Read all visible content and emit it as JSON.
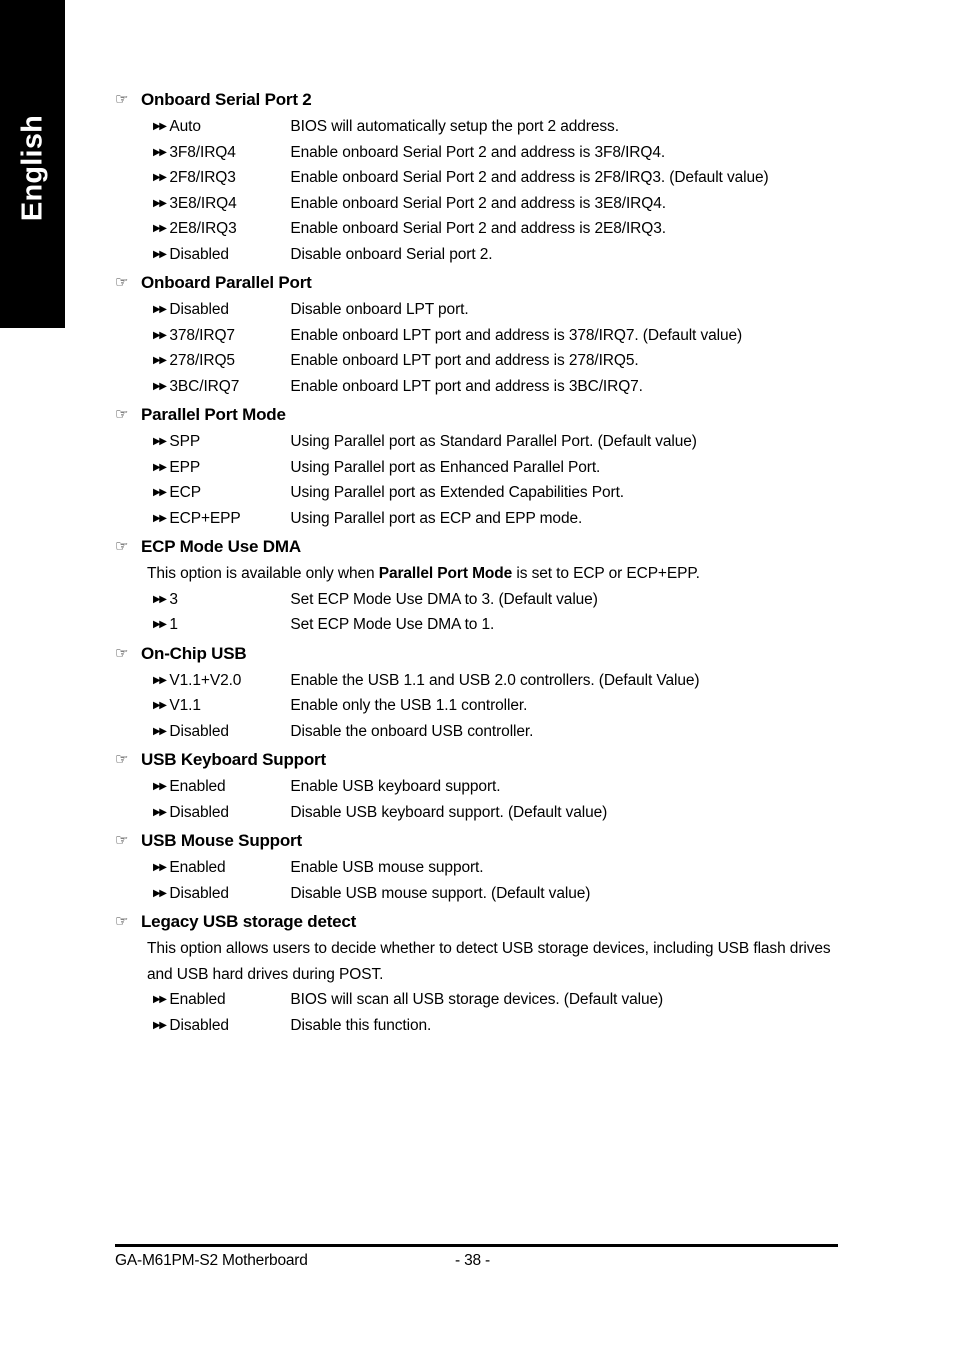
{
  "language_tab": {
    "label": "English",
    "background_color": "#000000",
    "text_color": "#ffffff"
  },
  "icons": {
    "section_bullet": "☞",
    "option_bullet": "▶▶"
  },
  "sections": [
    {
      "title": "Onboard Serial Port 2",
      "note": null,
      "options": [
        {
          "name": "Auto",
          "desc": "BIOS will automatically setup the port 2 address."
        },
        {
          "name": "3F8/IRQ4",
          "desc": "Enable onboard Serial Port 2 and address is 3F8/IRQ4."
        },
        {
          "name": "2F8/IRQ3",
          "desc": "Enable onboard Serial Port 2 and address is 2F8/IRQ3. (Default value)"
        },
        {
          "name": "3E8/IRQ4",
          "desc": "Enable onboard Serial Port 2 and address is 3E8/IRQ4."
        },
        {
          "name": "2E8/IRQ3",
          "desc": "Enable onboard Serial Port 2 and address is 2E8/IRQ3."
        },
        {
          "name": "Disabled",
          "desc": "Disable onboard Serial port 2."
        }
      ]
    },
    {
      "title": "Onboard Parallel Port",
      "note": null,
      "options": [
        {
          "name": "Disabled",
          "desc": "Disable onboard LPT port."
        },
        {
          "name": "378/IRQ7",
          "desc": "Enable onboard LPT port and address is 378/IRQ7. (Default value)"
        },
        {
          "name": "278/IRQ5",
          "desc": "Enable onboard LPT port and address is 278/IRQ5."
        },
        {
          "name": "3BC/IRQ7",
          "desc": "Enable onboard LPT port and address is 3BC/IRQ7."
        }
      ]
    },
    {
      "title": "Parallel Port Mode",
      "note": null,
      "options": [
        {
          "name": "SPP",
          "desc": "Using Parallel port as Standard Parallel Port. (Default value)"
        },
        {
          "name": "EPP",
          "desc": "Using Parallel port as Enhanced Parallel Port."
        },
        {
          "name": "ECP",
          "desc": "Using Parallel port as Extended Capabilities Port."
        },
        {
          "name": "ECP+EPP",
          "desc": "Using Parallel port as ECP and EPP mode."
        }
      ]
    },
    {
      "title": "ECP Mode Use DMA",
      "note_parts": {
        "before": "This option is available only when ",
        "bold": "Parallel Port Mode",
        "after": " is set to ECP or ECP+EPP."
      },
      "options": [
        {
          "name": "3",
          "desc": "Set ECP Mode Use DMA to 3. (Default value)"
        },
        {
          "name": "1",
          "desc": "Set ECP Mode Use DMA to 1."
        }
      ]
    },
    {
      "title": "On-Chip USB",
      "note": null,
      "options": [
        {
          "name": "V1.1+V2.0",
          "desc": "Enable the USB 1.1 and USB 2.0 controllers. (Default Value)"
        },
        {
          "name": "V1.1",
          "desc": "Enable only the USB 1.1 controller."
        },
        {
          "name": "Disabled",
          "desc": "Disable the onboard USB controller."
        }
      ]
    },
    {
      "title": "USB Keyboard Support",
      "note": null,
      "options": [
        {
          "name": "Enabled",
          "desc": "Enable USB keyboard support."
        },
        {
          "name": "Disabled",
          "desc": "Disable USB keyboard support. (Default value)"
        }
      ]
    },
    {
      "title": "USB Mouse Support",
      "note": null,
      "options": [
        {
          "name": "Enabled",
          "desc": "Enable USB mouse support."
        },
        {
          "name": "Disabled",
          "desc": "Disable USB mouse support. (Default value)"
        }
      ]
    },
    {
      "title": "Legacy USB storage detect",
      "note": "This option allows users to decide whether to detect USB storage devices, including USB flash drives and USB hard drives during POST.",
      "options": [
        {
          "name": "Enabled",
          "desc": "BIOS will scan all USB storage devices. (Default value)"
        },
        {
          "name": "Disabled",
          "desc": "Disable this function."
        }
      ]
    }
  ],
  "footer": {
    "left": "GA-M61PM-S2 Motherboard",
    "center": "- 38 -"
  }
}
